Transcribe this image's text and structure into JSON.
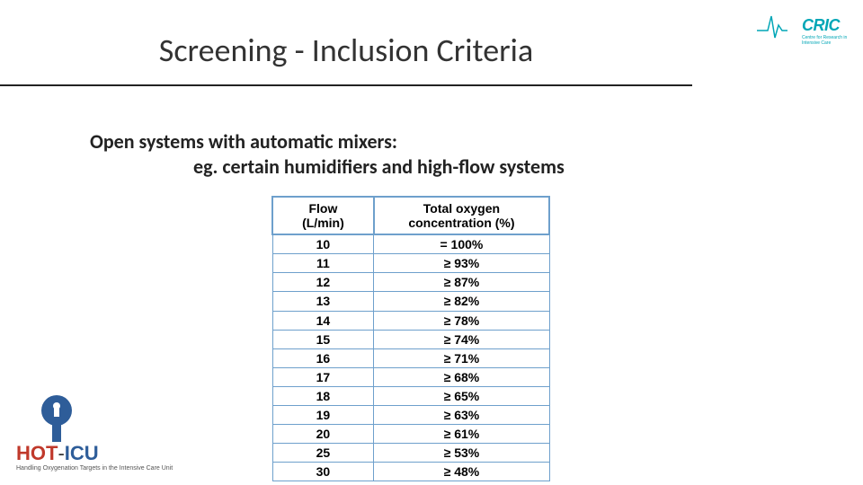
{
  "title": "Screening - Inclusion Criteria",
  "body": {
    "line1": "Open systems with automatic mixers:",
    "line2": "eg. certain humidifiers and high-flow systems"
  },
  "cric_logo": {
    "text": "CRIC",
    "sub": "Centre for Research in Intensive Care"
  },
  "hoticu_logo": {
    "hot": "HOT",
    "dash": "-",
    "icu": "ICU",
    "sub": "Handling Oxygenation Targets in the Intensive Care Unit"
  },
  "table": {
    "headers": {
      "flow_h1": "Flow",
      "flow_h2": "(L/min)",
      "conc_h1": "Total oxygen",
      "conc_h2": "concentration (%)"
    },
    "rows": [
      {
        "flow": "10",
        "conc": "= 100%"
      },
      {
        "flow": "11",
        "conc": "≥ 93%"
      },
      {
        "flow": "12",
        "conc": "≥ 87%"
      },
      {
        "flow": "13",
        "conc": "≥ 82%"
      },
      {
        "flow": "14",
        "conc": "≥ 78%"
      },
      {
        "flow": "15",
        "conc": "≥ 74%"
      },
      {
        "flow": "16",
        "conc": "≥ 71%"
      },
      {
        "flow": "17",
        "conc": "≥ 68%"
      },
      {
        "flow": "18",
        "conc": "≥ 65%"
      },
      {
        "flow": "19",
        "conc": "≥ 63%"
      },
      {
        "flow": "20",
        "conc": "≥ 61%"
      },
      {
        "flow": "25",
        "conc": "≥ 53%"
      },
      {
        "flow": "30",
        "conc": "≥ 48%"
      }
    ]
  }
}
